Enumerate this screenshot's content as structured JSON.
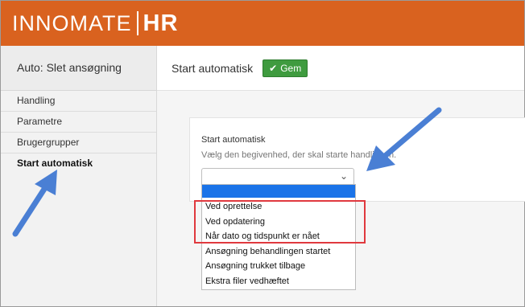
{
  "header": {
    "logo_word": "INNOMATE",
    "logo_hr": "HR"
  },
  "sidebar": {
    "title": "Auto: Slet ansøgning",
    "items": [
      {
        "label": "Handling"
      },
      {
        "label": "Parametre"
      },
      {
        "label": "Brugergrupper"
      },
      {
        "label": "Start automatisk",
        "active": true
      }
    ]
  },
  "main": {
    "title": "Start automatisk",
    "save_label": "Gem"
  },
  "panel": {
    "label": "Start automatisk",
    "help": "Vælg den begivenhed, der skal starte handlingen.",
    "select_value": ""
  },
  "dropdown": {
    "options": [
      "Ved oprettelse",
      "Ved opdatering",
      "Når dato og tidspunkt er nået",
      "Ansøgning behandlingen startet",
      "Ansøgning trukket tilbage",
      "Ekstra filer vedhæftet"
    ]
  },
  "colors": {
    "brand": "#d9621f",
    "save": "#3f9b3f",
    "selected_option": "#1a73e8",
    "highlight": "#e0393e",
    "arrow": "#4a7fd4"
  }
}
